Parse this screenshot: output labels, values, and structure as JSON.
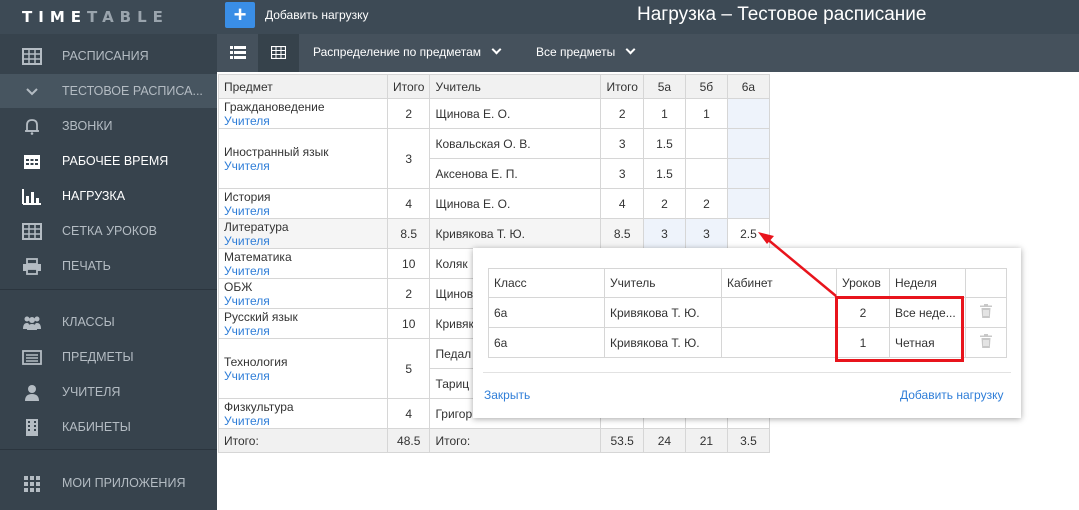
{
  "app": {
    "logo_bold": "TIME",
    "logo_dim": "TABLE",
    "add_label": "Добавить нагрузку",
    "title": "Нагрузка – Тестовое расписание"
  },
  "sidebar": [
    {
      "label": "РАСПИСАНИЯ",
      "icon": "grid-icon"
    },
    {
      "label": "ТЕСТОВОЕ РАСПИСА...",
      "icon": "chevron-down-icon"
    },
    {
      "label": "ЗВОНКИ",
      "icon": "bell-icon"
    },
    {
      "label": "РАБОЧЕЕ ВРЕМЯ",
      "icon": "calendar-icon"
    },
    {
      "label": "НАГРУЗКА",
      "icon": "bar-chart-icon"
    },
    {
      "label": "СЕТКА УРОКОВ",
      "icon": "grid-icon"
    },
    {
      "label": "ПЕЧАТЬ",
      "icon": "printer-icon"
    },
    {
      "label": "КЛАССЫ",
      "icon": "users-icon"
    },
    {
      "label": "ПРЕДМЕТЫ",
      "icon": "list-icon"
    },
    {
      "label": "УЧИТЕЛЯ",
      "icon": "user-icon"
    },
    {
      "label": "КАБИНЕТЫ",
      "icon": "building-icon"
    },
    {
      "label": "МОИ ПРИЛОЖЕНИЯ",
      "icon": "apps-icon"
    }
  ],
  "toolbar": {
    "view_list_icon": "list-view-icon",
    "view_grid_icon": "table-view-icon",
    "distribution": "Распределение по предметам",
    "filter": "Все предметы"
  },
  "table": {
    "headers": [
      "Предмет",
      "Итого",
      "Учитель",
      "Итого",
      "5а",
      "5б",
      "6а"
    ],
    "teachers_link": "Учителя",
    "subjects": [
      {
        "name": "Граждановедение",
        "total": "2",
        "teachers": [
          {
            "name": "Щинова Е. О.",
            "total": "2",
            "c5a": "1",
            "c5b": "1",
            "c6a": ""
          }
        ]
      },
      {
        "name": "Иностранный язык",
        "total": "3",
        "teachers": [
          {
            "name": "Ковальская О. В.",
            "total": "3",
            "c5a": "1.5",
            "c5b": "",
            "c6a": ""
          },
          {
            "name": "Аксенова Е. П.",
            "total": "3",
            "c5a": "1.5",
            "c5b": "",
            "c6a": ""
          }
        ]
      },
      {
        "name": "История",
        "total": "4",
        "teachers": [
          {
            "name": "Щинова Е. О.",
            "total": "4",
            "c5a": "2",
            "c5b": "2",
            "c6a": ""
          }
        ]
      },
      {
        "name": "Литература",
        "total": "8.5",
        "teachers": [
          {
            "name": "Кривякова Т. Ю.",
            "total": "8.5",
            "c5a": "3",
            "c5b": "3",
            "c6a": "2.5"
          }
        ]
      },
      {
        "name": "Математика",
        "total": "10",
        "teachers": [
          {
            "name": "Коляк",
            "total": "",
            "c5a": "",
            "c5b": "",
            "c6a": ""
          }
        ]
      },
      {
        "name": "ОБЖ",
        "total": "2",
        "teachers": [
          {
            "name": "Щинов",
            "total": "",
            "c5a": "",
            "c5b": "",
            "c6a": ""
          }
        ]
      },
      {
        "name": "Русский язык",
        "total": "10",
        "teachers": [
          {
            "name": "Кривяк",
            "total": "",
            "c5a": "",
            "c5b": "",
            "c6a": ""
          }
        ]
      },
      {
        "name": "Технология",
        "total": "5",
        "teachers": [
          {
            "name": "Педал",
            "total": "",
            "c5a": "",
            "c5b": "",
            "c6a": ""
          },
          {
            "name": "Тариц",
            "total": "",
            "c5a": "",
            "c5b": "",
            "c6a": ""
          }
        ]
      },
      {
        "name": "Физкультура",
        "total": "4",
        "teachers": [
          {
            "name": "Григор",
            "total": "",
            "c5a": "",
            "c5b": "",
            "c6a": ""
          }
        ]
      }
    ],
    "footer": {
      "label": "Итого:",
      "total": "48.5",
      "label2": "Итого:",
      "total2": "53.5",
      "c5a": "24",
      "c5b": "21",
      "c6a": "3.5"
    }
  },
  "popup": {
    "headers": [
      "Класс",
      "Учитель",
      "Кабинет",
      "Уроков",
      "Неделя"
    ],
    "rows": [
      {
        "class": "6а",
        "teacher": "Кривякова Т. Ю.",
        "room": "",
        "lessons": "2",
        "week": "Все неде..."
      },
      {
        "class": "6а",
        "teacher": "Кривякова Т. Ю.",
        "room": "",
        "lessons": "1",
        "week": "Четная"
      }
    ],
    "close": "Закрыть",
    "add": "Добавить нагрузку",
    "delete_icon": "trash-icon"
  },
  "annotation": {
    "color": "#e8141c"
  }
}
